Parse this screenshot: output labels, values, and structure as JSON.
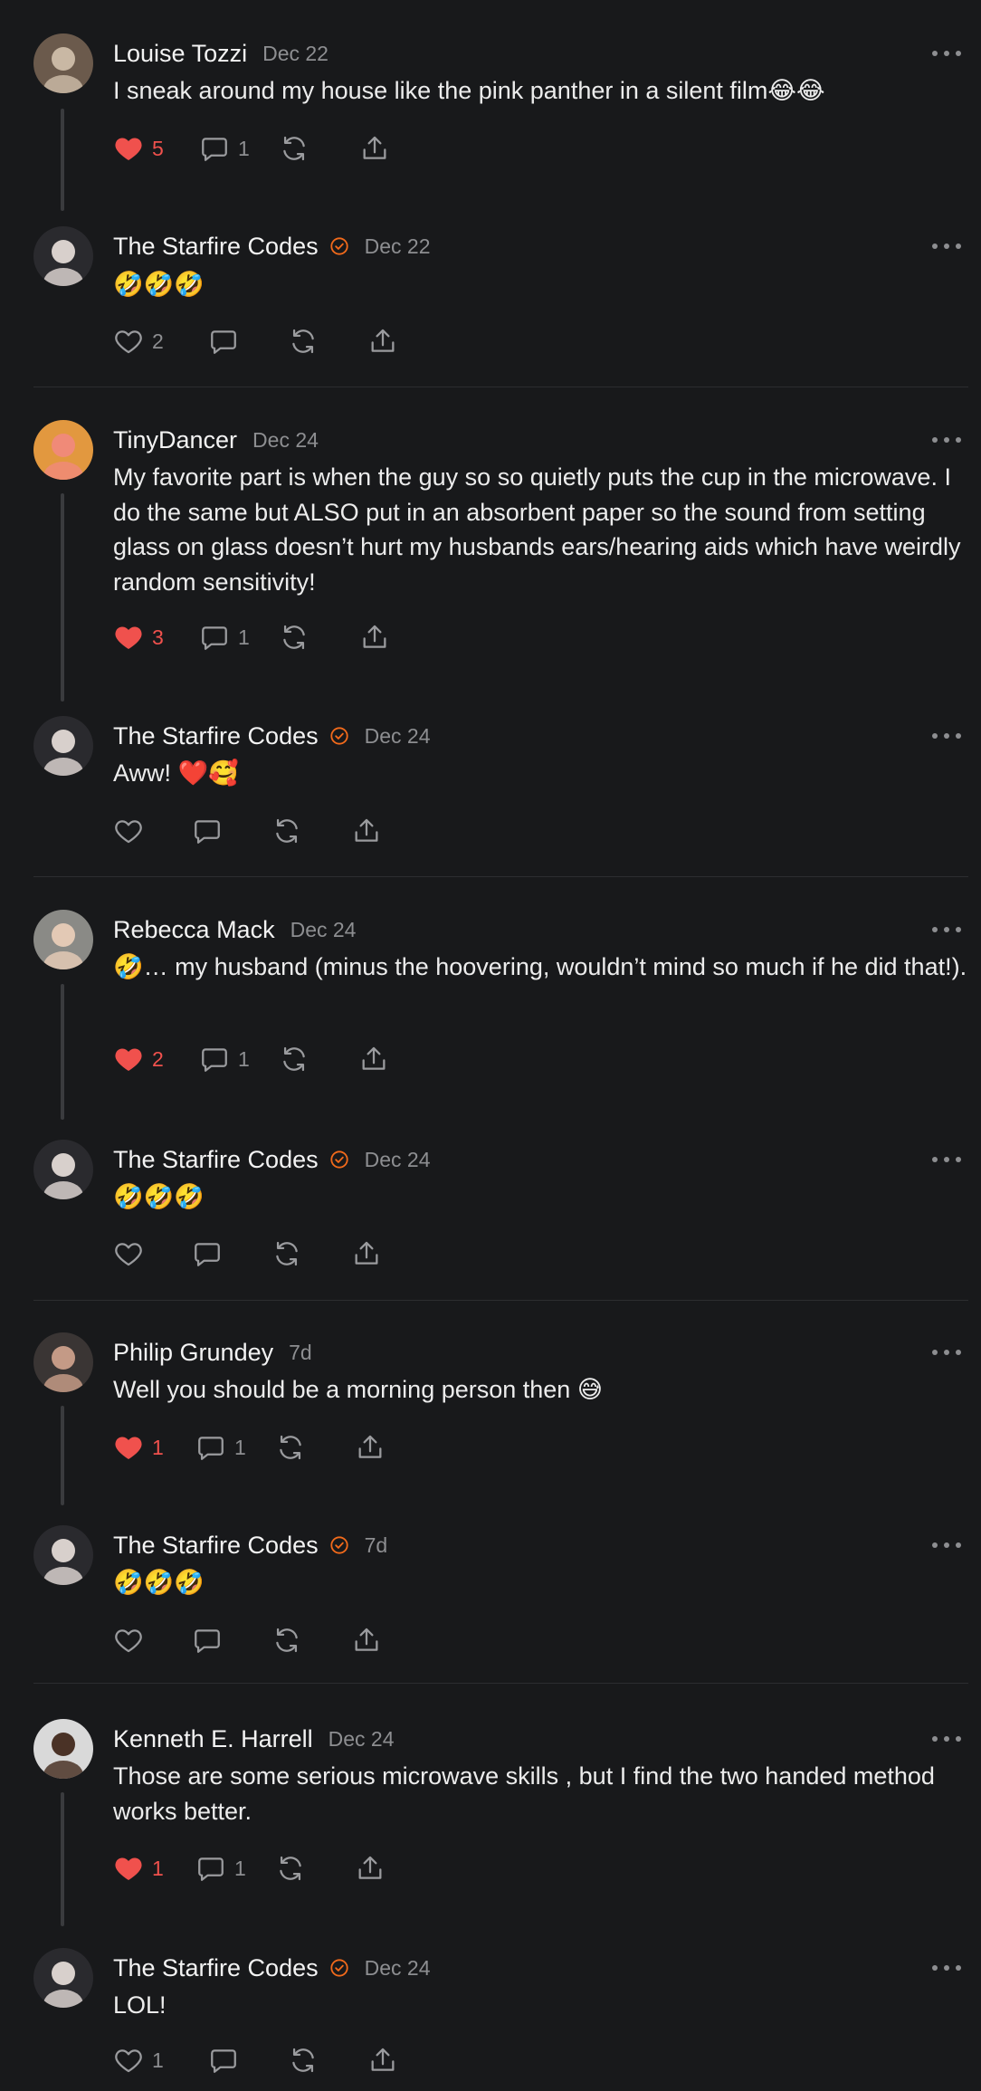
{
  "app": {
    "name": "Comment thread"
  },
  "colors": {
    "background": "#18191b",
    "like": "#f0514d",
    "verified": "#f26a1b",
    "muted": "#8d8e91"
  },
  "icons": {
    "like": "heart-icon",
    "comment": "comment-bubble-icon",
    "repost": "repost-icon",
    "share": "share-icon",
    "more": "more-icon",
    "verified": "verified-check-icon"
  },
  "posts": [
    {
      "author": "Louise Tozzi",
      "verified": false,
      "date": "Dec 22",
      "text": "I sneak around my house like the pink panther in a silent film😂😂",
      "likes": "5",
      "liked": true,
      "replies": "1",
      "avatar": {
        "bg": "#6b5a4c",
        "fg": "#c9b8a4"
      }
    },
    {
      "author": "The Starfire Codes",
      "verified": true,
      "date": "Dec 22",
      "text": "🤣🤣🤣",
      "likes": "2",
      "liked": false,
      "replies": "",
      "avatar": {
        "bg": "#2a2a2e",
        "fg": "#d8d0cc"
      }
    },
    {
      "author": "TinyDancer",
      "verified": false,
      "date": "Dec 24",
      "text": "My favorite part is when the guy so so quietly puts the cup in the microwave. I do the same but ALSO put in an absorbent paper so the sound from setting glass on glass doesn’t hurt my husbands ears/hearing aids which have weirdly random sensitivity!",
      "likes": "3",
      "liked": true,
      "replies": "1",
      "avatar": {
        "bg": "#e2983f",
        "fg": "#f08a78"
      }
    },
    {
      "author": "The Starfire Codes",
      "verified": true,
      "date": "Dec 24",
      "text": "Aww! ❤️🥰",
      "likes": "",
      "liked": false,
      "replies": "",
      "avatar": {
        "bg": "#2a2a2e",
        "fg": "#d8d0cc"
      }
    },
    {
      "author": "Rebecca Mack",
      "verified": false,
      "date": "Dec 24",
      "text": "🤣… my husband (minus the hoovering, wouldn’t mind so much if he did that!).",
      "likes": "2",
      "liked": true,
      "replies": "1",
      "avatar": {
        "bg": "#8a8a86",
        "fg": "#e3c9b5"
      }
    },
    {
      "author": "The Starfire Codes",
      "verified": true,
      "date": "Dec 24",
      "text": "🤣🤣🤣",
      "likes": "",
      "liked": false,
      "replies": "",
      "avatar": {
        "bg": "#2a2a2e",
        "fg": "#d8d0cc"
      }
    },
    {
      "author": "Philip Grundey",
      "verified": false,
      "date": "7d",
      "text": "Well you should be a morning person then 😅",
      "likes": "1",
      "liked": true,
      "replies": "1",
      "avatar": {
        "bg": "#3a3534",
        "fg": "#c49a86"
      }
    },
    {
      "author": "The Starfire Codes",
      "verified": true,
      "date": "7d",
      "text": "🤣🤣🤣",
      "likes": "",
      "liked": false,
      "replies": "",
      "avatar": {
        "bg": "#2a2a2e",
        "fg": "#d8d0cc"
      }
    },
    {
      "author": "Kenneth E. Harrell",
      "verified": false,
      "date": "Dec 24",
      "text": "Those are some serious microwave skills , but I find the two handed method works better.",
      "likes": "1",
      "liked": true,
      "replies": "1",
      "avatar": {
        "bg": "#d9d9d9",
        "fg": "#4a3226"
      }
    },
    {
      "author": "The Starfire Codes",
      "verified": true,
      "date": "Dec 24",
      "text": "LOL!",
      "likes": "1",
      "liked": false,
      "replies": "",
      "avatar": {
        "bg": "#2a2a2e",
        "fg": "#d8d0cc"
      }
    }
  ]
}
